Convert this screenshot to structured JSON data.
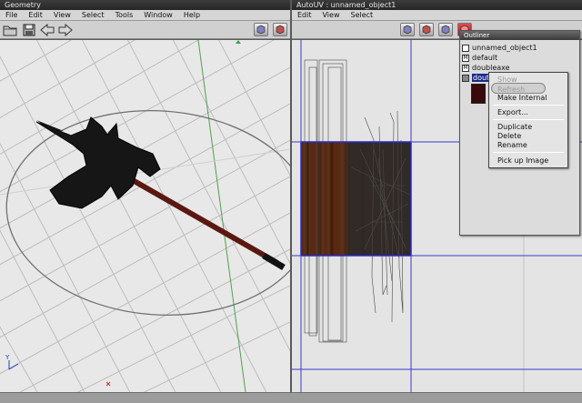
{
  "geometry_window": {
    "title": "Geometry",
    "menu": [
      "File",
      "Edit",
      "View",
      "Select",
      "Tools",
      "Window",
      "Help"
    ],
    "toolbar_icons": [
      "open-folder-icon",
      "save-disk-icon",
      "back-arrow-icon",
      "forward-arrow-icon",
      "view-cube-icon",
      "view-cube-red-icon"
    ]
  },
  "autouv_window": {
    "title": "AutoUV : unnamed_object1",
    "menu": [
      "Edit",
      "View",
      "Select"
    ],
    "toolbar_icons": [
      "view-cube-icon",
      "view-cube-red-icon",
      "view-cube-icon",
      "view-cube-active-icon"
    ]
  },
  "outliner": {
    "title": "Outliner",
    "items": [
      {
        "label": "unnamed_object1",
        "icon": "object-icon"
      },
      {
        "label": "default",
        "icon": "material-icon"
      },
      {
        "label": "doubleaxe",
        "icon": "material-icon"
      },
      {
        "label": "dout",
        "icon": "image-icon",
        "selected": true
      }
    ]
  },
  "context_menu": {
    "items": [
      {
        "label": "Show",
        "enabled": false
      },
      {
        "label": "Refresh",
        "enabled": false,
        "highlighted": true
      },
      {
        "label": "Make Internal",
        "enabled": true
      },
      {
        "separator": true
      },
      {
        "label": "Export...",
        "enabled": true
      },
      {
        "separator": true
      },
      {
        "label": "Duplicate",
        "enabled": true
      },
      {
        "label": "Delete",
        "enabled": true
      },
      {
        "label": "Rename",
        "enabled": true
      },
      {
        "separator": true
      },
      {
        "label": "Pick up Image",
        "enabled": true
      }
    ]
  },
  "colors": {
    "grid_line": "#bdbdbd",
    "viewport_bg": "#e8e8e8",
    "axe_head": "#161616",
    "handle": "#5a1810",
    "uv_highlight": "#0000cc",
    "texture_wood": "#5a2a10",
    "selection_blue": "#1a2a8a"
  }
}
